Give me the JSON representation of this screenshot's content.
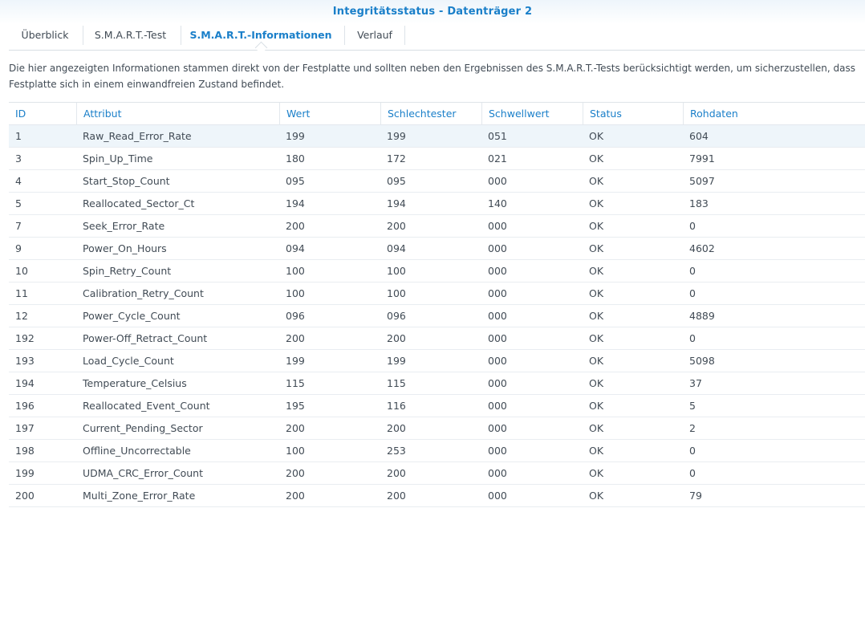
{
  "window": {
    "title": "Integritätsstatus - Datenträger 2"
  },
  "tabs": [
    {
      "label": "Überblick",
      "active": false
    },
    {
      "label": "S.M.A.R.T.-Test",
      "active": false
    },
    {
      "label": "S.M.A.R.T.-Informationen",
      "active": true
    },
    {
      "label": "Verlauf",
      "active": false
    }
  ],
  "description": "Die hier angezeigten Informationen stammen direkt von der Festplatte und sollten neben den Ergebnissen des S.M.A.R.T.-Tests berücksichtigt werden, um sicherzustellen, dass Festplatte sich in einem einwandfreien Zustand befindet.",
  "table": {
    "columns": [
      "ID",
      "Attribut",
      "Wert",
      "Schlechtester",
      "Schwellwert",
      "Status",
      "Rohdaten"
    ],
    "rows": [
      [
        "1",
        "Raw_Read_Error_Rate",
        "199",
        "199",
        "051",
        "OK",
        "604"
      ],
      [
        "3",
        "Spin_Up_Time",
        "180",
        "172",
        "021",
        "OK",
        "7991"
      ],
      [
        "4",
        "Start_Stop_Count",
        "095",
        "095",
        "000",
        "OK",
        "5097"
      ],
      [
        "5",
        "Reallocated_Sector_Ct",
        "194",
        "194",
        "140",
        "OK",
        "183"
      ],
      [
        "7",
        "Seek_Error_Rate",
        "200",
        "200",
        "000",
        "OK",
        "0"
      ],
      [
        "9",
        "Power_On_Hours",
        "094",
        "094",
        "000",
        "OK",
        "4602"
      ],
      [
        "10",
        "Spin_Retry_Count",
        "100",
        "100",
        "000",
        "OK",
        "0"
      ],
      [
        "11",
        "Calibration_Retry_Count",
        "100",
        "100",
        "000",
        "OK",
        "0"
      ],
      [
        "12",
        "Power_Cycle_Count",
        "096",
        "096",
        "000",
        "OK",
        "4889"
      ],
      [
        "192",
        "Power-Off_Retract_Count",
        "200",
        "200",
        "000",
        "OK",
        "0"
      ],
      [
        "193",
        "Load_Cycle_Count",
        "199",
        "199",
        "000",
        "OK",
        "5098"
      ],
      [
        "194",
        "Temperature_Celsius",
        "115",
        "115",
        "000",
        "OK",
        "37"
      ],
      [
        "196",
        "Reallocated_Event_Count",
        "195",
        "116",
        "000",
        "OK",
        "5"
      ],
      [
        "197",
        "Current_Pending_Sector",
        "200",
        "200",
        "000",
        "OK",
        "2"
      ],
      [
        "198",
        "Offline_Uncorrectable",
        "100",
        "253",
        "000",
        "OK",
        "0"
      ],
      [
        "199",
        "UDMA_CRC_Error_Count",
        "200",
        "200",
        "000",
        "OK",
        "0"
      ],
      [
        "200",
        "Multi_Zone_Error_Rate",
        "200",
        "200",
        "000",
        "OK",
        "79"
      ]
    ],
    "selected_row": 0
  },
  "colors": {
    "accent": "#1a7fc9",
    "text": "#414b55",
    "selected_row_bg": "#eef5fa",
    "border": "#e3e8ed"
  }
}
